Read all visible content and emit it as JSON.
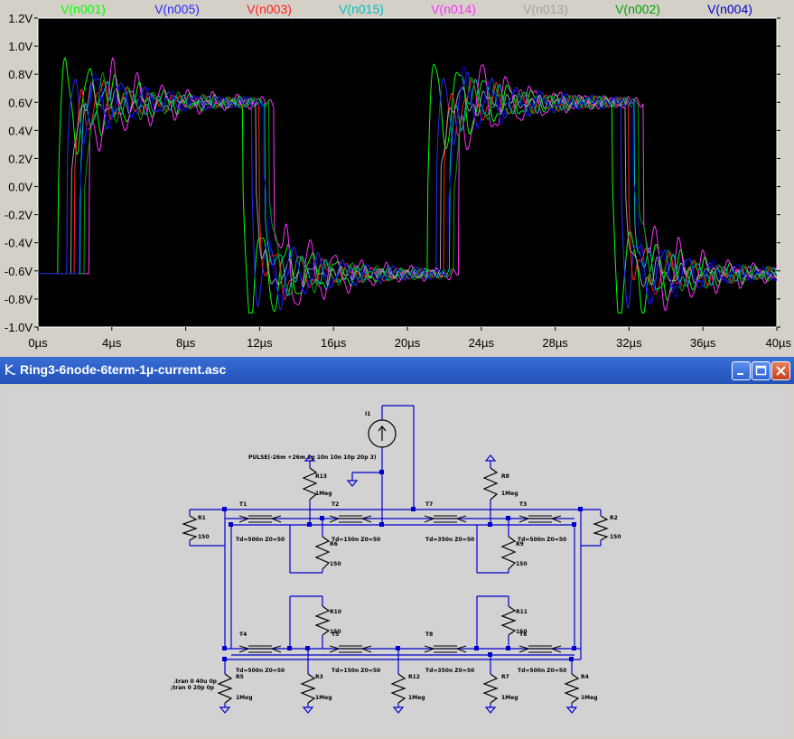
{
  "chart_data": {
    "type": "line",
    "xlabel": "",
    "ylabel": "",
    "xlim": [
      0,
      40
    ],
    "ylim": [
      -1.0,
      1.2
    ],
    "x_tick_labels": [
      "0µs",
      "4µs",
      "8µs",
      "12µs",
      "16µs",
      "20µs",
      "24µs",
      "28µs",
      "32µs",
      "36µs",
      "40µs"
    ],
    "y_tick_labels": [
      "1.2V",
      "1.0V",
      "0.8V",
      "0.6V",
      "0.4V",
      "0.2V",
      "0.0V",
      "-0.2V",
      "-0.4V",
      "-0.6V",
      "-0.8V",
      "-1.0V"
    ],
    "grid": false,
    "legend_position": "top",
    "series": [
      {
        "name": "V(n001)",
        "color": "#00ff00",
        "edges": [
          1.1,
          11.1,
          21.1,
          31.1
        ],
        "overshoot": 0.42
      },
      {
        "name": "V(n005)",
        "color": "#2a2aff",
        "edges": [
          1.6,
          11.6,
          21.6,
          31.6
        ],
        "overshoot": 0.33
      },
      {
        "name": "V(n003)",
        "color": "#ff2020",
        "edges": [
          2.0,
          12.0,
          22.0,
          32.0
        ],
        "overshoot": 0.22
      },
      {
        "name": "V(n015)",
        "color": "#00c0c0",
        "edges": [
          2.3,
          12.3,
          22.3,
          32.3
        ],
        "overshoot": 0.18
      },
      {
        "name": "V(n014)",
        "color": "#ff30ff",
        "edges": [
          2.8,
          12.8,
          22.8,
          32.8
        ],
        "overshoot": 0.38
      },
      {
        "name": "V(n013)",
        "color": "#a0a0a0",
        "edges": [
          1.8,
          11.8,
          21.8,
          31.8
        ],
        "overshoot": 0.12
      },
      {
        "name": "V(n002)",
        "color": "#00a000",
        "edges": [
          2.5,
          12.5,
          22.5,
          32.5
        ],
        "overshoot": 0.2
      },
      {
        "name": "V(n004)",
        "color": "#0000c8",
        "edges": [
          2.2,
          12.2,
          22.2,
          32.2
        ],
        "overshoot": 0.26
      }
    ],
    "levels": {
      "high": 0.6,
      "low": -0.62
    }
  },
  "window": {
    "title": "Ring3-6node-6term-1µ-current.asc"
  },
  "schematic": {
    "source_label": "I1",
    "source_value": "PULSE(-26m +26m 1p 10n 10n 10p 20p 3)",
    "resistors": [
      {
        "name": "R1",
        "value": "150"
      },
      {
        "name": "R2",
        "value": "150"
      },
      {
        "name": "R13",
        "value": "1Meg"
      },
      {
        "name": "R8",
        "value": "1Meg"
      },
      {
        "name": "R9",
        "value": "150"
      },
      {
        "name": "R10",
        "value": "150"
      },
      {
        "name": "R11",
        "value": "150"
      },
      {
        "name": "R5",
        "value": "1Meg"
      },
      {
        "name": "R3",
        "value": "1Meg"
      },
      {
        "name": "R12",
        "value": "1Meg"
      },
      {
        "name": "R7",
        "value": "1Meg"
      },
      {
        "name": "R4",
        "value": "1Meg"
      },
      {
        "name": "R6",
        "value": "150"
      }
    ],
    "tlines": [
      {
        "name": "T1",
        "spec": "Td=500n Z0=50"
      },
      {
        "name": "T2",
        "spec": "Td=150n Z0=50"
      },
      {
        "name": "T7",
        "spec": "Td=350n Z0=50"
      },
      {
        "name": "T3",
        "spec": "Td=500n Z0=50"
      },
      {
        "name": "T4",
        "spec": "Td=500n Z0=50"
      },
      {
        "name": "T5",
        "spec": "Td=150n Z0=50"
      },
      {
        "name": "T8",
        "spec": "Td=350n Z0=50"
      },
      {
        "name": "T6",
        "spec": "Td=500n Z0=50"
      }
    ],
    "directive1": ".tran 0 40u 0p",
    "directive2": ";tran 0 20p 0p"
  }
}
